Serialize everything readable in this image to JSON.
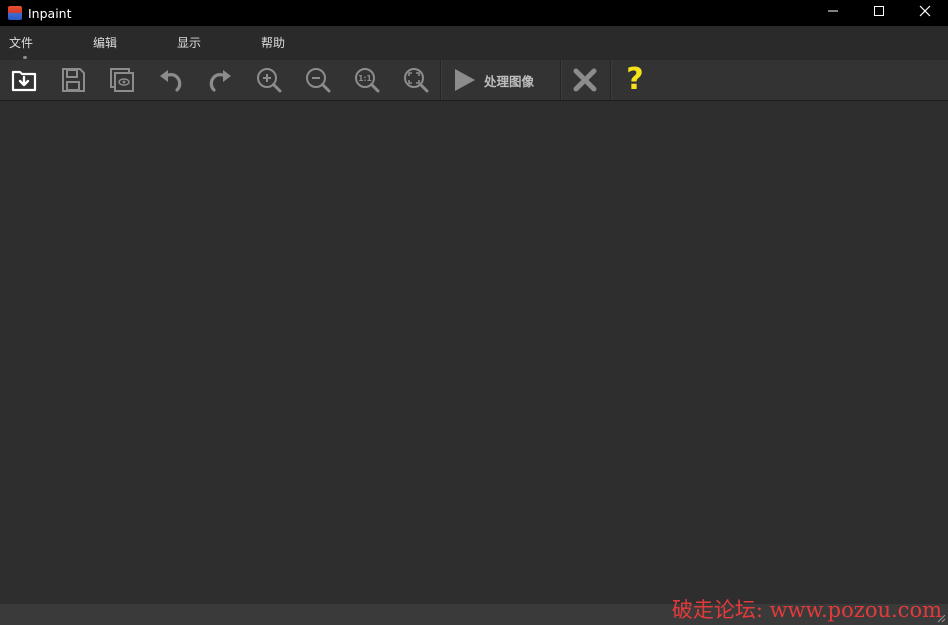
{
  "window": {
    "title": "Inpaint"
  },
  "menu": {
    "items": [
      "文件",
      "编辑",
      "显示",
      "帮助"
    ]
  },
  "toolbar": {
    "buttons": [
      "open-icon",
      "save-icon",
      "preview-icon",
      "undo-icon",
      "redo-icon",
      "zoom-in-icon",
      "zoom-out-icon",
      "actual-size-icon",
      "fit-window-icon",
      "play-icon",
      "close-x-icon",
      "help-icon"
    ],
    "process_label": "处理图像",
    "help_glyph": "?",
    "help_color": "#f5e21a"
  },
  "watermark": "破走论坛: www.pozou.com",
  "colors": {
    "bg": "#2c2c2c",
    "toolbar": "#333333",
    "titlebar": "#000000",
    "watermark": "#e23a3a"
  }
}
